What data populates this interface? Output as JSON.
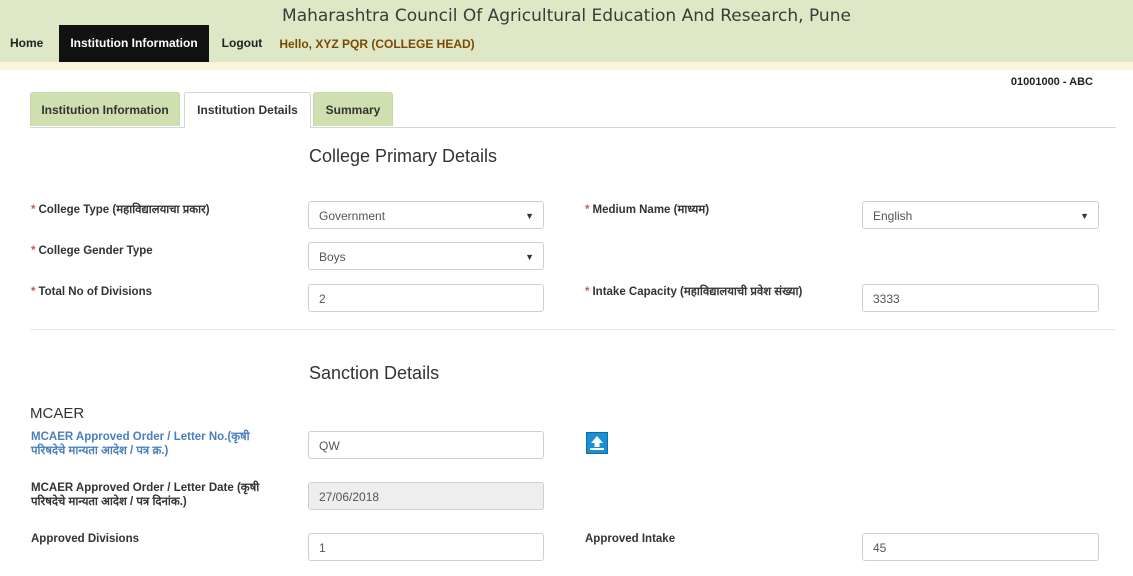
{
  "header": {
    "title": "Maharashtra Council Of Agricultural Education And Research, Pune",
    "nav": {
      "home": "Home",
      "institution_information": "Institution Information",
      "logout": "Logout"
    },
    "greeting": "Hello, XYZ PQR  (COLLEGE HEAD)"
  },
  "institution_code": "01001000 - ABC",
  "tabs": [
    {
      "label": "Institution Information"
    },
    {
      "label": "Institution Details",
      "active": true
    },
    {
      "label": "Summary"
    }
  ],
  "primary": {
    "title": "College Primary Details",
    "college_type": {
      "label": "College Type (महाविद्यालयाचा प्रकार)",
      "value": "Government"
    },
    "medium_name": {
      "label": "Medium Name (माध्यम)",
      "value": "English"
    },
    "gender_type": {
      "label": "College Gender Type",
      "value": "Boys"
    },
    "divisions": {
      "label": "Total No of Divisions",
      "value": "2"
    },
    "intake_capacity": {
      "label": "Intake Capacity (महाविद्यालयाची प्रवेश संख्या)",
      "value": "3333"
    }
  },
  "sanction": {
    "title": "Sanction Details",
    "subhead": "MCAER",
    "order_no": {
      "label_line1": "MCAER Approved Order / Letter No.(कृषी",
      "label_line2": "परिषदेचे मान्यता आदेश / पत्र क्र.)",
      "value": "QW"
    },
    "order_date": {
      "label_line1": "MCAER Approved Order / Letter Date (कृषी",
      "label_line2": "परिषदेचे मान्यता आदेश / पत्र दिनांक.)",
      "value": "27/06/2018"
    },
    "approved_divisions": {
      "label": "Approved Divisions",
      "value": "1"
    },
    "approved_intake": {
      "label": "Approved Intake",
      "value": "45"
    }
  },
  "colors": {
    "header_bg": "#dfe8c6",
    "tab_bg": "#cfe0b0",
    "required": "#d9534f",
    "link_label": "#4a7fbf",
    "upload_btn": "#1b8fd0"
  },
  "icons": {
    "upload": "upload-arrow-icon",
    "select_caret": "caret-down-icon"
  }
}
